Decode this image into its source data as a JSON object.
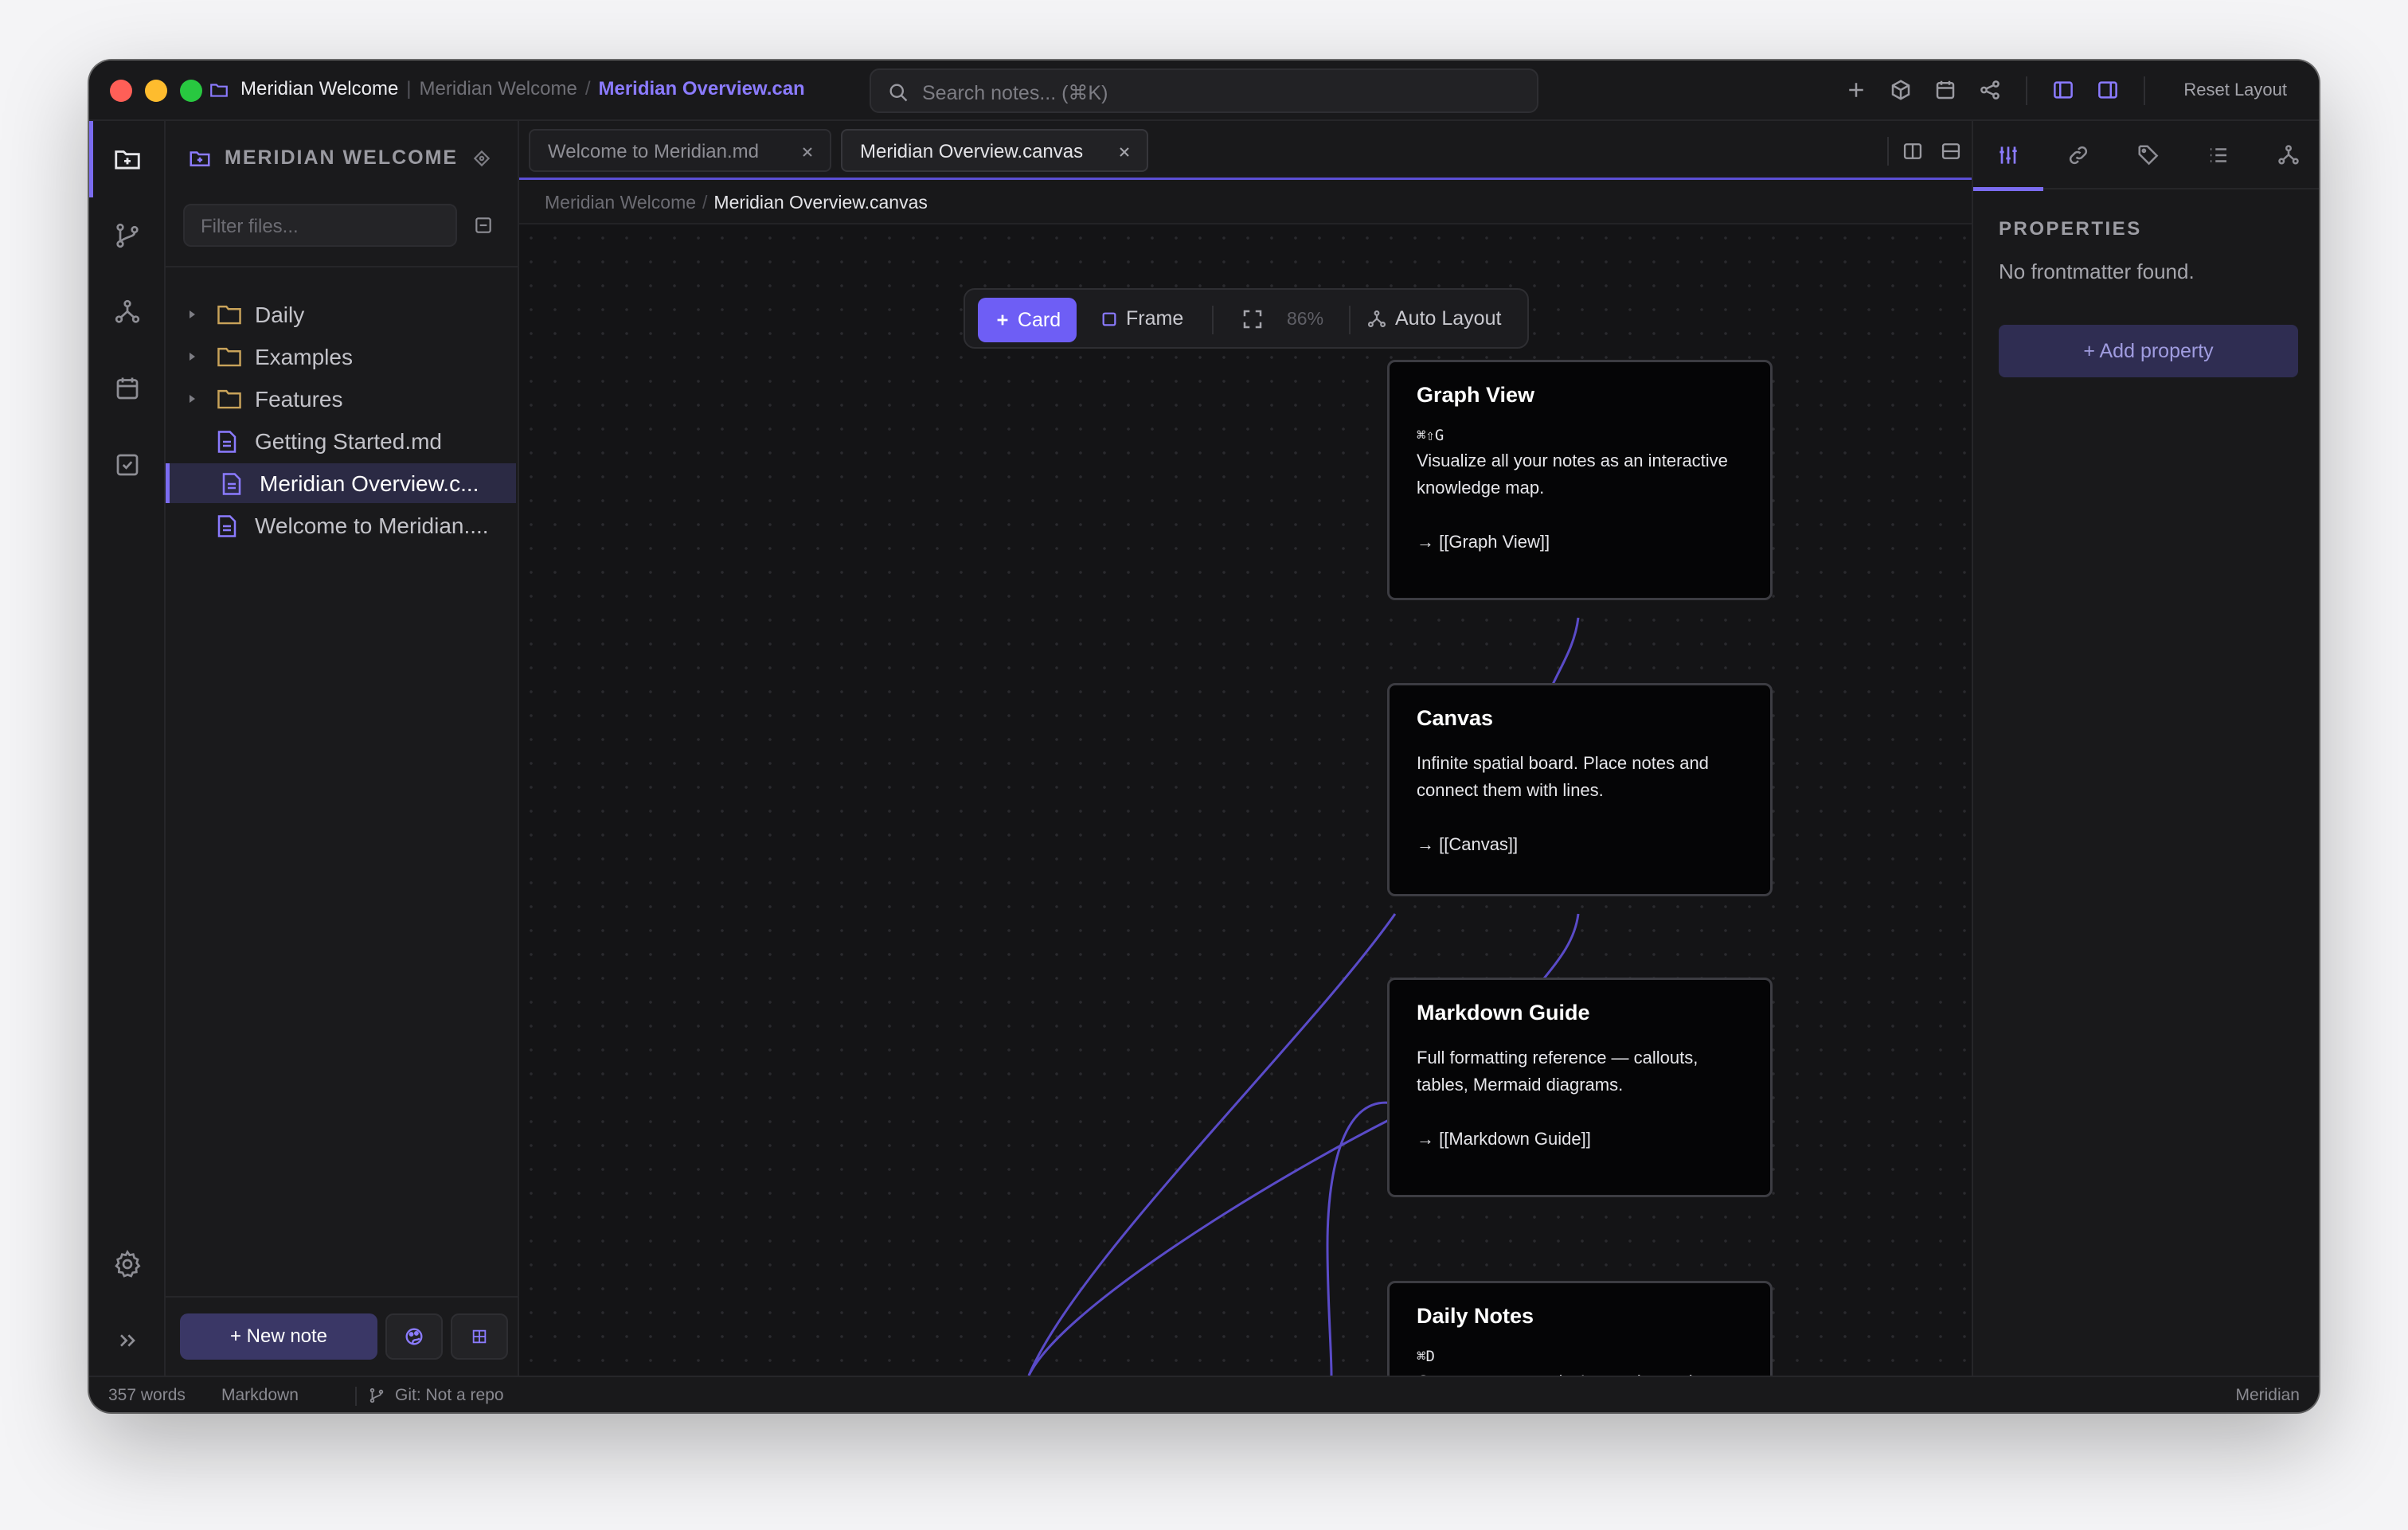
{
  "titlebar": {
    "vault": "Meridian Welcome",
    "crumb_vault": "Meridian Welcome",
    "crumb_separator": "/",
    "crumb_active": "Meridian Overview.can",
    "search_placeholder": "Search notes... (⌘K)",
    "reset_layout": "Reset Layout"
  },
  "sidebar": {
    "vault_name": "MERIDIAN WELCOME",
    "filter_placeholder": "Filter files...",
    "tree": [
      {
        "label": "Daily",
        "type": "folder"
      },
      {
        "label": "Examples",
        "type": "folder"
      },
      {
        "label": "Features",
        "type": "folder"
      },
      {
        "label": "Getting Started.md",
        "type": "file"
      },
      {
        "label": "Meridian Overview.c...",
        "type": "file",
        "selected": true
      },
      {
        "label": "Welcome to Meridian....",
        "type": "file"
      }
    ],
    "new_note": "+ New note"
  },
  "editor": {
    "tabs": [
      {
        "label": "Welcome to Meridian.md",
        "active": false
      },
      {
        "label": "Meridian Overview.canvas",
        "active": true
      }
    ],
    "breadcrumb": {
      "vault": "Meridian Welcome",
      "separator": "/",
      "file": "Meridian Overview.canvas"
    },
    "toolbar": {
      "card": "Card",
      "frame": "Frame",
      "zoom": "86%",
      "auto_layout": "Auto Layout"
    },
    "nodes": [
      {
        "title": "Graph View",
        "shortcut": "⌘⇧G",
        "desc": "Visualize all your notes as an interactive knowledge map.",
        "link": "→ [[Graph View]]"
      },
      {
        "title": "Canvas",
        "shortcut": "",
        "desc": "Infinite spatial board. Place notes and connect them with lines.",
        "link": "→ [[Canvas]]"
      },
      {
        "title": "Markdown Guide",
        "shortcut": "",
        "desc": "Full formatting reference — callouts, tables, Mermaid diagrams.",
        "link": "→ [[Markdown Guide]]"
      },
      {
        "title": "Daily Notes",
        "shortcut": "⌘D",
        "desc": "Open or create today's note instantly.",
        "link": ""
      }
    ]
  },
  "right_panel": {
    "heading": "PROPERTIES",
    "empty": "No frontmatter found.",
    "add_property": "+ Add property"
  },
  "statusbar": {
    "words": "357 words",
    "mode": "Markdown",
    "git": "Git: Not a repo",
    "app": "Meridian"
  },
  "colors": {
    "accent": "#7b6cf0",
    "accent_button": "#6e5ef5",
    "background": "#161618",
    "edge": "#5a4bc8"
  }
}
